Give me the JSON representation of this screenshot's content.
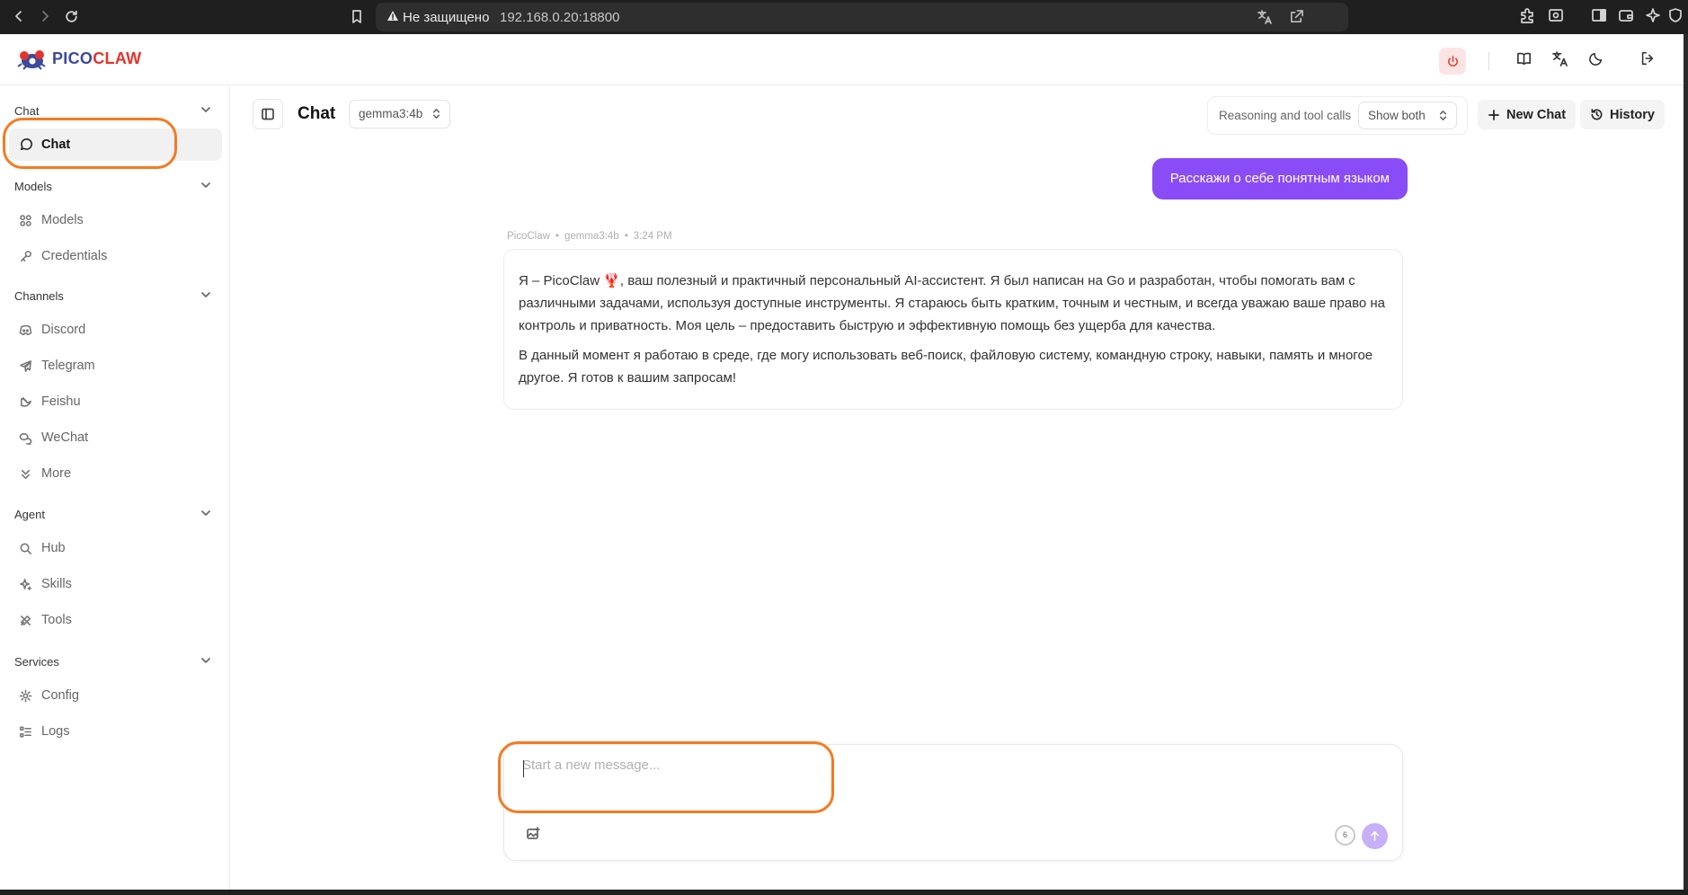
{
  "browser": {
    "security_label": "Не защищено",
    "url": "192.168.0.20:18800",
    "brave_label": "B"
  },
  "app": {
    "logo_part1": "PICO",
    "logo_part2": "CLAW"
  },
  "sidebar": {
    "sections": [
      {
        "title": "Chat",
        "items": [
          {
            "label": "Chat",
            "icon": "chat-bubble-icon",
            "active": true
          }
        ]
      },
      {
        "title": "Models",
        "items": [
          {
            "label": "Models",
            "icon": "models-icon"
          },
          {
            "label": "Credentials",
            "icon": "key-icon"
          }
        ]
      },
      {
        "title": "Channels",
        "items": [
          {
            "label": "Discord",
            "icon": "discord-icon"
          },
          {
            "label": "Telegram",
            "icon": "telegram-icon"
          },
          {
            "label": "Feishu",
            "icon": "feishu-icon"
          },
          {
            "label": "WeChat",
            "icon": "wechat-icon"
          },
          {
            "label": "More",
            "icon": "chevrons-down-icon"
          }
        ]
      },
      {
        "title": "Agent",
        "items": [
          {
            "label": "Hub",
            "icon": "search-icon"
          },
          {
            "label": "Skills",
            "icon": "sparkles-icon"
          },
          {
            "label": "Tools",
            "icon": "tools-icon"
          }
        ]
      },
      {
        "title": "Services",
        "items": [
          {
            "label": "Config",
            "icon": "gear-icon"
          },
          {
            "label": "Logs",
            "icon": "list-icon"
          }
        ]
      }
    ]
  },
  "topbar": {
    "title": "Chat",
    "model": "gemma3:4b",
    "reasoning_label": "Reasoning and tool calls",
    "reasoning_value": "Show both",
    "new_chat_label": "New Chat",
    "history_label": "History"
  },
  "messages": {
    "user": "Расскажи о себе понятным языком",
    "assistant_sender": "PicoClaw",
    "assistant_model": "gemma3:4b",
    "assistant_time": "3:24 PM",
    "assistant_paragraphs": [
      "Я – PicoClaw 🦞, ваш полезный и практичный персональный AI-ассистент. Я был написан на Go и разработан, чтобы помогать вам с различными задачами, используя доступные инструменты. Я стараюсь быть кратким, точным и честным, и всегда уважаю ваше право на контроль и приватность. Моя цель – предоставить быструю и эффективную помощь без ущерба для качества.",
      "В данный момент я работаю в среде, где могу использовать веб-поиск, файловую систему, командную строку, навыки, память и многое другое.  Я готов к вашим запросам!"
    ]
  },
  "composer": {
    "placeholder": "Start a new message...",
    "value": "",
    "context_count": "6"
  },
  "colors": {
    "accent": "#8a4cf6",
    "callout": "#f47b20",
    "power_bg": "#fde4e4",
    "power_fg": "#e0443a"
  }
}
